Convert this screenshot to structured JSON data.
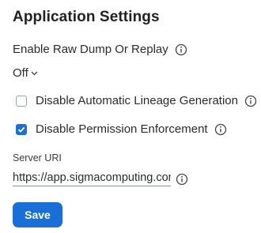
{
  "page": {
    "title": "Application Settings"
  },
  "raw_dump": {
    "label": "Enable Raw Dump Or Replay",
    "selected": "Off"
  },
  "options": [
    {
      "label": "Disable Automatic Lineage Generation",
      "checked": false
    },
    {
      "label": "Disable Permission Enforcement",
      "checked": true
    }
  ],
  "server": {
    "label": "Server URI",
    "value": "https://app.sigmacomputing.com"
  },
  "actions": {
    "save_label": "Save"
  },
  "colors": {
    "accent": "#1a6fd6",
    "checkbox_border": "#9aa3ad"
  },
  "icons": {
    "info": "info-circle-icon",
    "chevron": "chevron-down-icon",
    "check": "checkmark-icon"
  }
}
